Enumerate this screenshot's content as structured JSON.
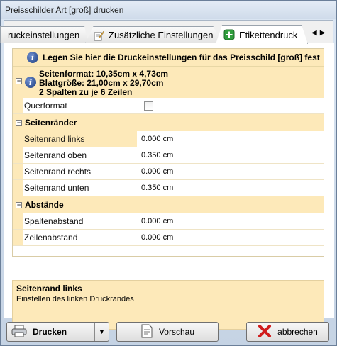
{
  "window": {
    "title": "Preisschilder Art [groß] drucken"
  },
  "tabs": [
    {
      "label": "ruckeinstellungen",
      "icon": "none"
    },
    {
      "label": "Zusätzliche Einstellungen",
      "icon": "pen-paper-icon"
    },
    {
      "label": "Etikettendruck",
      "icon": "green-plus-icon"
    }
  ],
  "grid": {
    "info": "Legen Sie hier die Druckeinstellungen für das Preisschild [groß] fest",
    "format_lines": [
      "Seitenformat: 10,35cm x 4,73cm",
      "Blattgröße: 21,00cm x 29,70cm",
      "2 Spalten zu je 6 Zeilen"
    ],
    "landscape_label": "Querformat",
    "landscape_checked": false,
    "margins_title": "Seitenränder",
    "margins": [
      {
        "label": "Seitenrand links",
        "value": "0.000 cm"
      },
      {
        "label": "Seitenrand oben",
        "value": "0.350 cm"
      },
      {
        "label": "Seitenrand rechts",
        "value": "0.000 cm"
      },
      {
        "label": "Seitenrand unten",
        "value": "0.350 cm"
      }
    ],
    "spacing_title": "Abstände",
    "spacing": [
      {
        "label": "Spaltenabstand",
        "value": "0.000 cm"
      },
      {
        "label": "Zeilenabstand",
        "value": "0.000 cm"
      }
    ]
  },
  "description": {
    "title": "Seitenrand links",
    "text": "Einstellen des linken Druckrandes"
  },
  "buttons": {
    "print": "Drucken",
    "preview": "Vorschau",
    "cancel": "abbrechen"
  },
  "colors": {
    "accent_panel": "#fde9b9",
    "cancel_icon": "#d01c1c"
  }
}
